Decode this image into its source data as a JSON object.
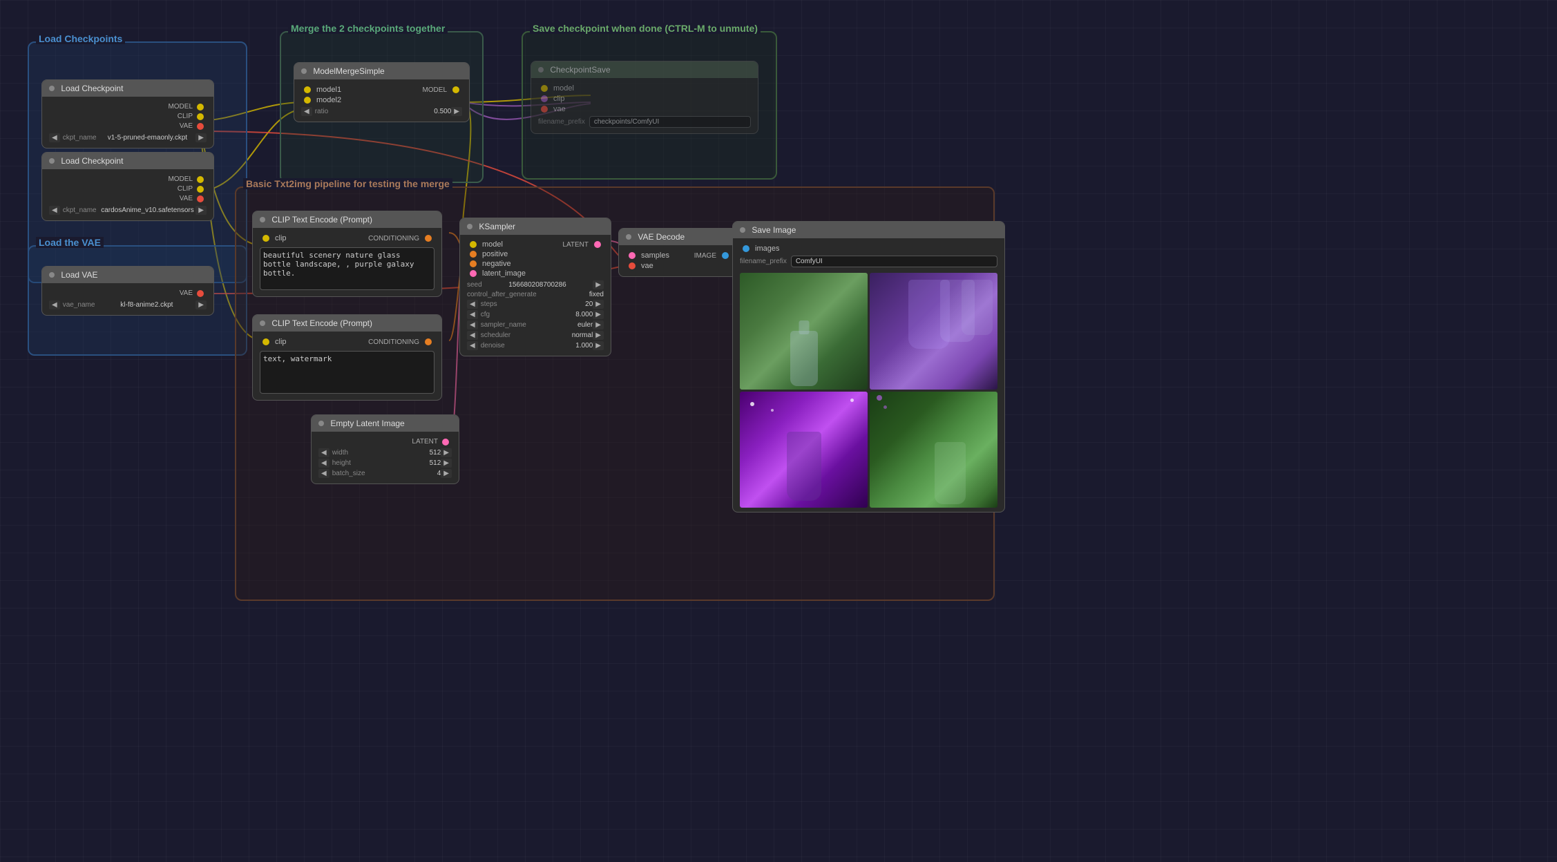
{
  "canvas": {
    "bg_color": "#1a1a2e"
  },
  "groups": [
    {
      "id": "load-checkpoints",
      "label": "Load Checkpoints",
      "color": "#2a5080",
      "title_color": "#4a90d0"
    },
    {
      "id": "load-vae",
      "label": "Load the VAE",
      "color": "#2a5080",
      "title_color": "#4a90d0"
    },
    {
      "id": "merge-group",
      "label": "Merge the 2 checkpoints together",
      "color": "#3a5a4a",
      "title_color": "#5aaa7a"
    },
    {
      "id": "save-group",
      "label": "Save checkpoint when done (CTRL-M to unmute)",
      "color": "#3a5a3a",
      "title_color": "#6aaa6a"
    },
    {
      "id": "txt2img-group",
      "label": "Basic Txt2img pipeline for testing the merge",
      "color": "#5a3a2a",
      "title_color": "#aa7a5a"
    }
  ],
  "nodes": {
    "load_checkpoint_1": {
      "title": "Load Checkpoint",
      "title_bg": "#555",
      "dot_color": "gray",
      "outputs": [
        "MODEL",
        "CLIP",
        "VAE"
      ],
      "ckpt_name": "v1-5-pruned-emaonly.ckpt"
    },
    "load_checkpoint_2": {
      "title": "Load Checkpoint",
      "title_bg": "#555",
      "dot_color": "gray",
      "outputs": [
        "MODEL",
        "CLIP",
        "VAE"
      ],
      "ckpt_name": "cardosAnime_v10.safetensors"
    },
    "model_merge": {
      "title": "ModelMergeSimple",
      "title_bg": "#555",
      "inputs": [
        "model1",
        "model2"
      ],
      "outputs": [
        "MODEL"
      ],
      "ratio": "0.500"
    },
    "checkpoint_save": {
      "title": "CheckpointSave",
      "title_bg": "#555",
      "inputs": [
        "model",
        "clip",
        "vae"
      ],
      "filename_prefix": "checkpoints/ComfyUI"
    },
    "load_vae": {
      "title": "Load VAE",
      "title_bg": "#555",
      "outputs": [
        "VAE"
      ],
      "vae_name": "kl-f8-anime2.ckpt"
    },
    "clip_text_encode_pos": {
      "title": "CLIP Text Encode (Prompt)",
      "title_bg": "#555",
      "inputs": [
        "clip"
      ],
      "outputs": [
        "CONDITIONING"
      ],
      "text": "beautiful scenery nature glass bottle landscape, , purple galaxy bottle."
    },
    "clip_text_encode_neg": {
      "title": "CLIP Text Encode (Prompt)",
      "title_bg": "#555",
      "inputs": [
        "clip"
      ],
      "outputs": [
        "CONDITIONING"
      ],
      "text": "text, watermark"
    },
    "ksampler": {
      "title": "KSampler",
      "title_bg": "#555",
      "inputs": [
        "model",
        "positive",
        "negative",
        "latent_image"
      ],
      "outputs": [
        "LATENT"
      ],
      "seed": "156680208700286",
      "control_after_generate": "fixed",
      "steps": "20",
      "cfg": "8.000",
      "sampler_name": "euler",
      "scheduler": "normal",
      "denoise": "1.000"
    },
    "vae_decode": {
      "title": "VAE Decode",
      "title_bg": "#555",
      "inputs": [
        "samples",
        "vae"
      ],
      "outputs": [
        "IMAGE"
      ]
    },
    "save_image": {
      "title": "Save Image",
      "title_bg": "#555",
      "inputs": [
        "images"
      ],
      "filename_prefix": "ComfyUI"
    },
    "empty_latent": {
      "title": "Empty Latent Image",
      "title_bg": "#555",
      "outputs": [
        "LATENT"
      ],
      "width": "512",
      "height": "512",
      "batch_size": "4"
    }
  }
}
